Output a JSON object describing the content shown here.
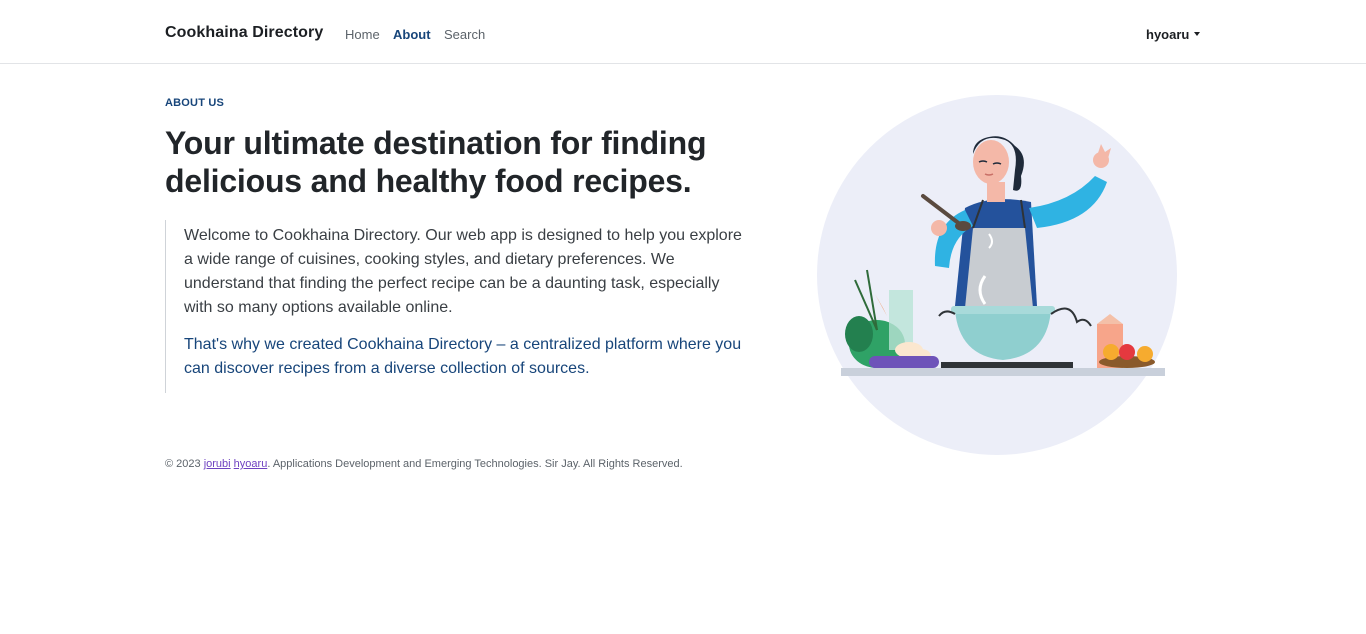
{
  "navbar": {
    "brand": "Cookhaina Directory",
    "links": [
      {
        "label": "Home",
        "active": false
      },
      {
        "label": "About",
        "active": true
      },
      {
        "label": "Search",
        "active": false
      }
    ],
    "user": {
      "label": "hyoaru",
      "icon": "caret-down-icon"
    }
  },
  "hero": {
    "eyebrow": "ABOUT US",
    "headline": "Your ultimate destination for finding delicious and healthy food recipes.",
    "body": "Welcome to Cookhaina Directory. Our web app is designed to help you explore a wide range of cuisines, cooking styles, and dietary preferences. We understand that finding the perfect recipe can be a daunting task, especially with so many options available online.",
    "highlight": "That's why we created Cookhaina Directory – a centralized platform where you can discover recipes from a diverse collection of sources."
  },
  "footer": {
    "prefix": "© 2023",
    "author1": "jorubi",
    "author2": "hyoaru",
    "suffix": ". Applications Development and Emerging Technologies. Sir Jay. All Rights Reserved."
  },
  "colors": {
    "accent": "#17457a",
    "link_visited": "#6f42c1",
    "illustration_bg": "#eceef8"
  },
  "illustration": {
    "icon": "chef-cooking-illustration"
  }
}
